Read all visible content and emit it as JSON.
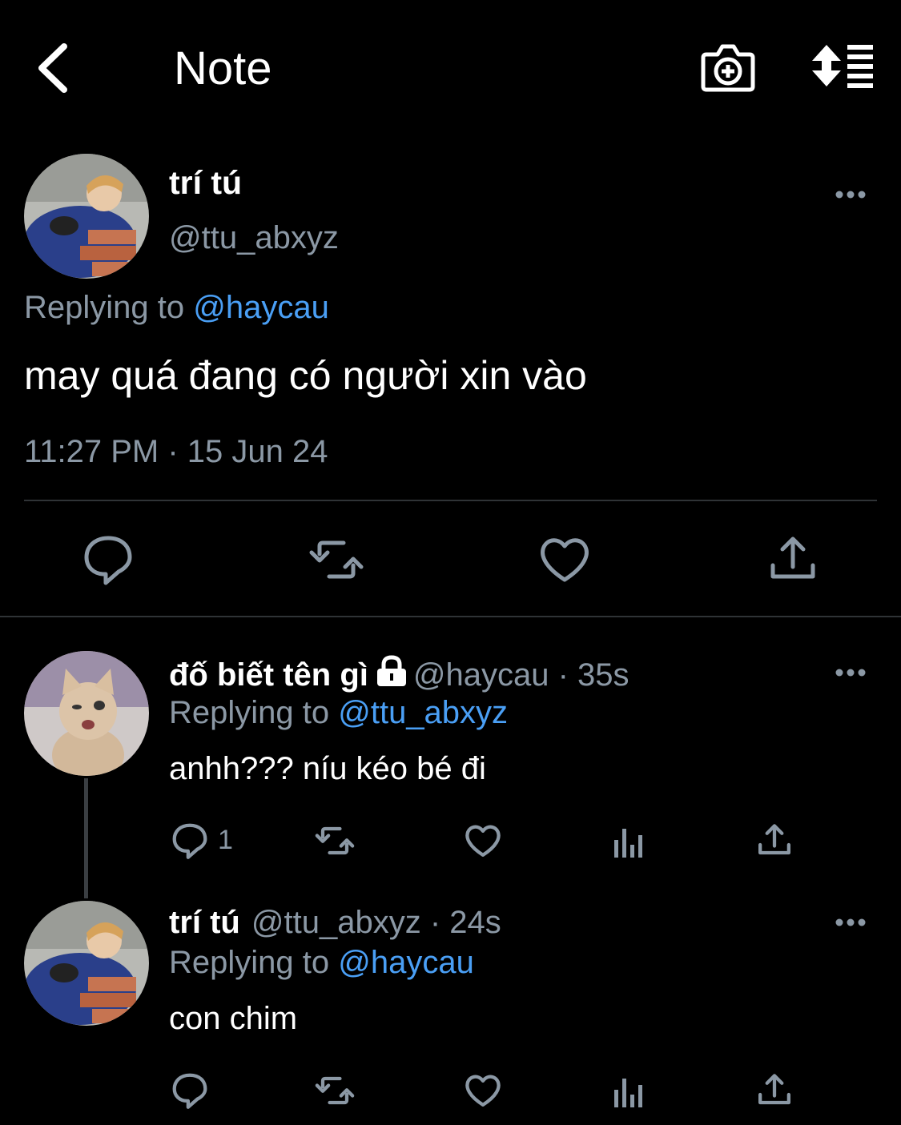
{
  "header": {
    "title": "Note"
  },
  "main_tweet": {
    "name": "trí tú",
    "handle": "@ttu_abxyz",
    "replying_prefix": "Replying to ",
    "replying_to": "@haycau",
    "text": "may quá đang có người xin vào",
    "timestamp": "11:27 PM · 15 Jun 24"
  },
  "replies": [
    {
      "name": "đố biết tên gì",
      "handle": "@haycau",
      "time": " · 35s",
      "replying_prefix": "Replying to ",
      "replying_to": "@ttu_abxyz",
      "text": "anhh??? níu kéo bé đi",
      "reply_count": "1"
    },
    {
      "name": "trí tú",
      "handle": "@ttu_abxyz",
      "time": " · 24s",
      "replying_prefix": "Replying to ",
      "replying_to": "@haycau",
      "text": "con chim"
    }
  ],
  "colors": {
    "background": "#000000",
    "accent": "#4a9ff5",
    "secondary_text": "#8b98a5",
    "divider": "#2f3336"
  }
}
